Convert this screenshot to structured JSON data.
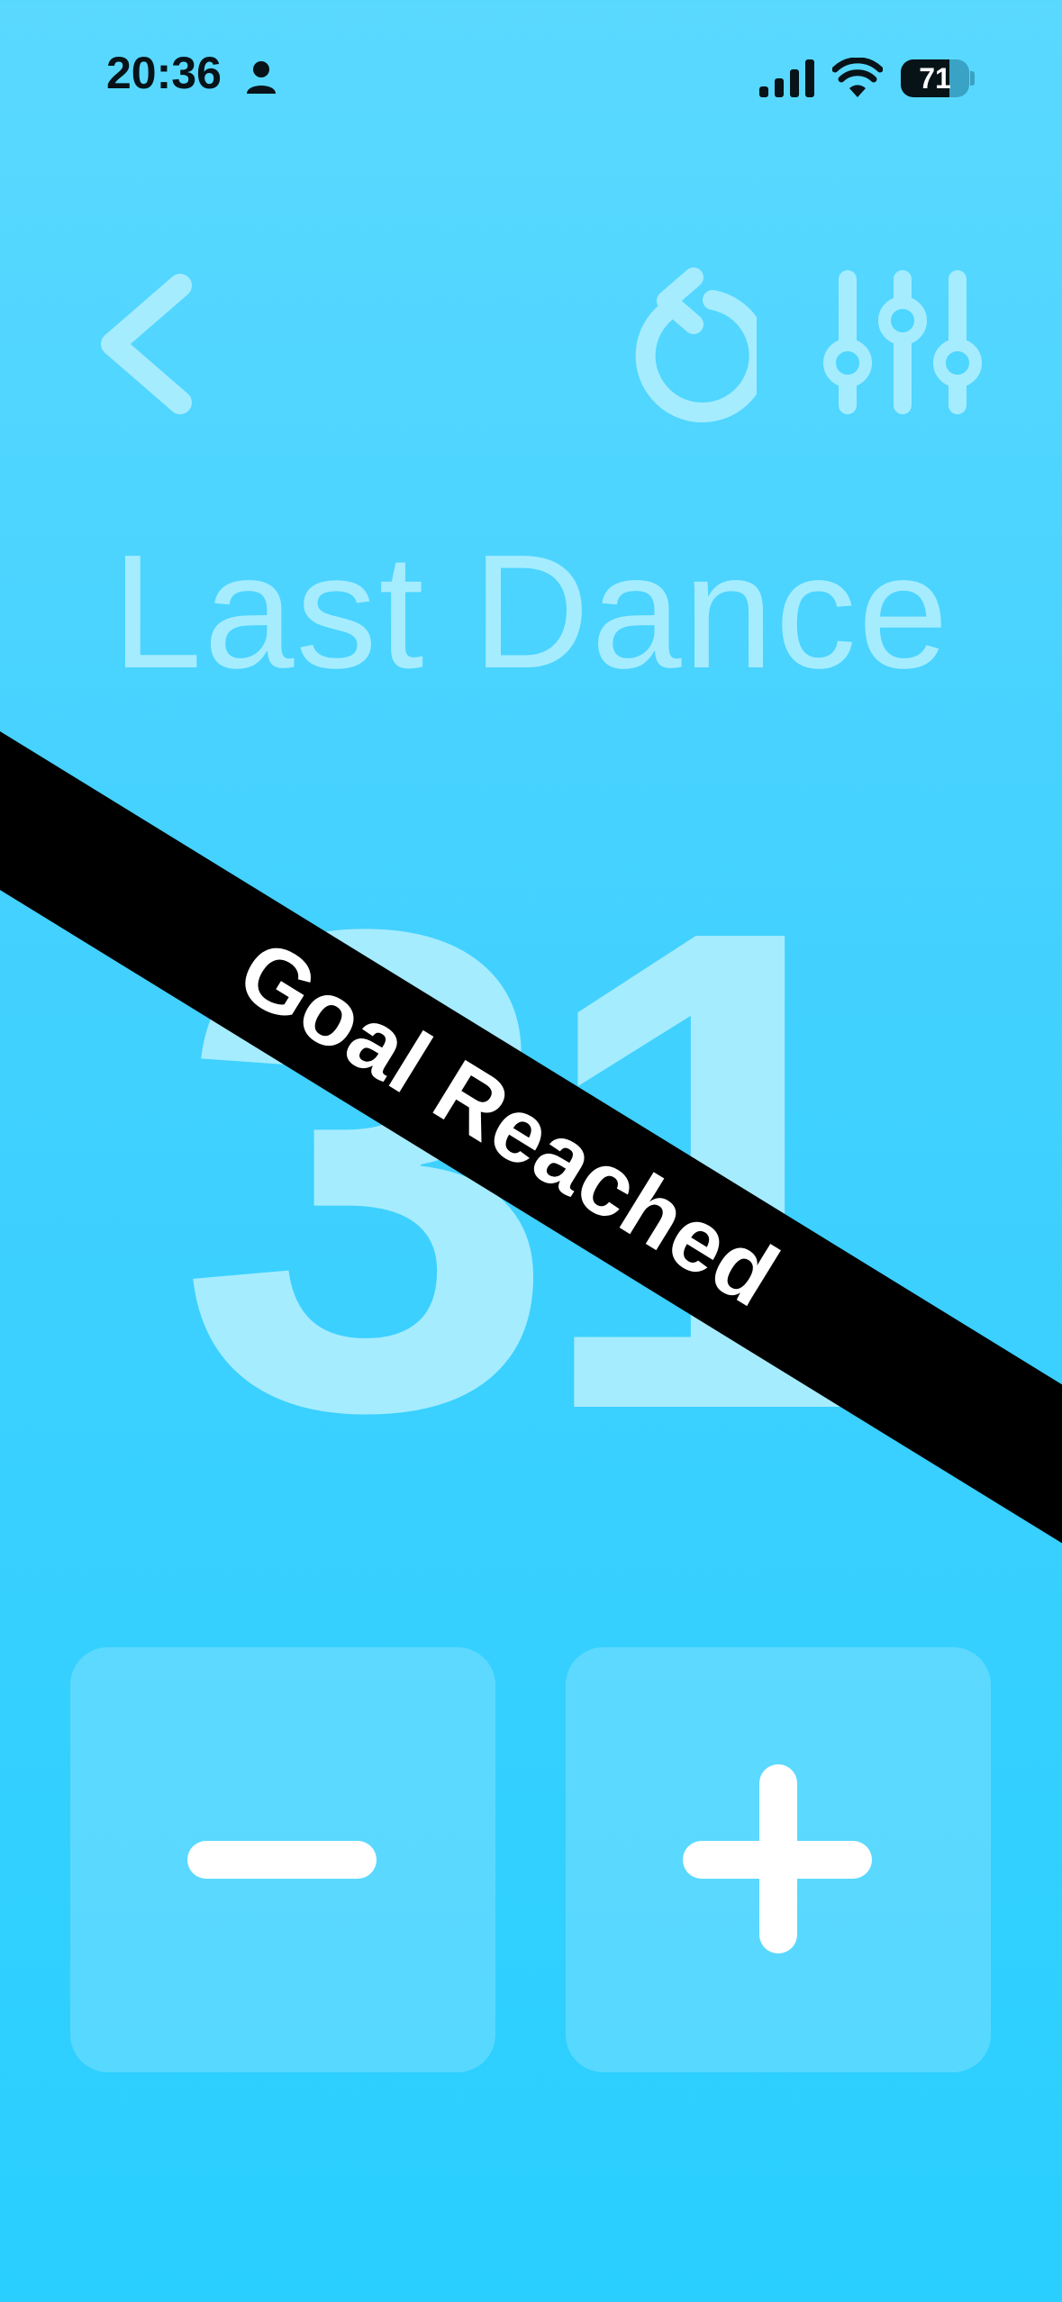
{
  "status_bar": {
    "time": "20:36",
    "battery_percent": "71",
    "battery_level": 0.71,
    "icons": [
      "person-icon",
      "cellular-signal-icon",
      "wifi-icon",
      "battery-icon"
    ]
  },
  "toolbar": {
    "back_icon": "chevron-left-icon",
    "reset_icon": "counterclockwise-arrow-icon",
    "settings_icon": "sliders-icon"
  },
  "counter": {
    "title": "Last Dance",
    "value": "31"
  },
  "banner": {
    "text": "Goal Reached"
  },
  "controls": {
    "decrement_icon": "minus-icon",
    "increment_icon": "plus-icon"
  },
  "colors": {
    "background_top": "#5ad9ff",
    "background_bottom": "#29cfff",
    "faded_text": "#a6ecff",
    "banner": "#000000",
    "banner_text": "#ffffff"
  }
}
